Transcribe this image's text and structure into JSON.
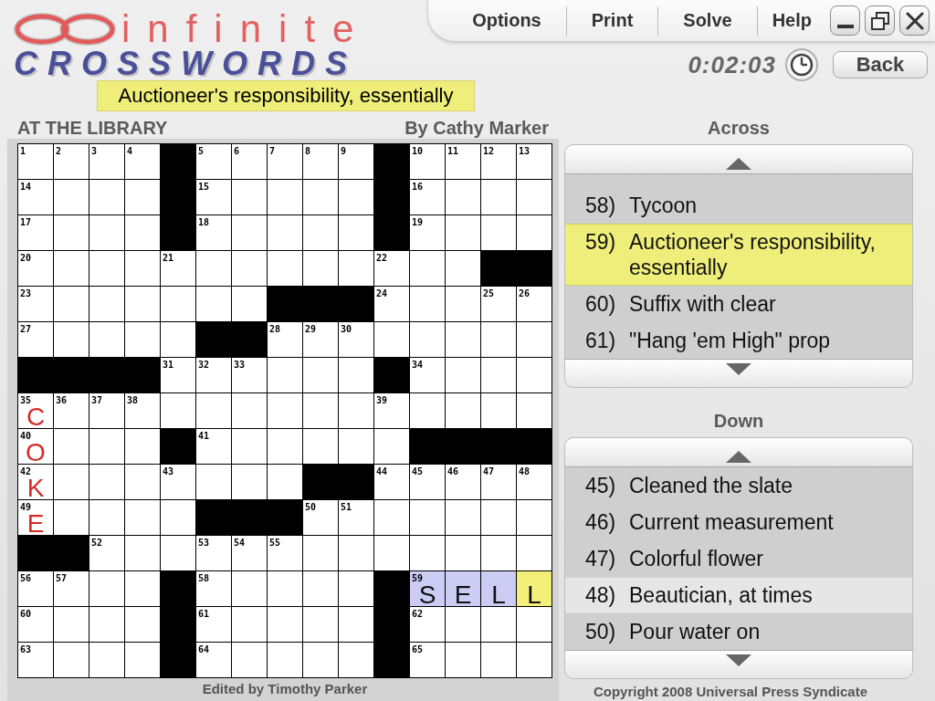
{
  "window": {
    "controls": [
      {
        "kind": "minimize"
      },
      {
        "kind": "restore"
      },
      {
        "kind": "close"
      }
    ]
  },
  "logo": {
    "line_1": "infinite",
    "line_2": "CROSSWORDS"
  },
  "menu": [
    "Options",
    "Print",
    "Solve",
    "Help"
  ],
  "timer": "0:02:03",
  "back_button": "Back",
  "current_clue": "Auctioneer's responsibility, essentially",
  "puzzle": {
    "title": "AT THE LIBRARY",
    "author": "By Cathy Marker"
  },
  "grid": {
    "rows": [
      [
        {
          "kind": "open",
          "number": "1",
          "selected": false,
          "highlighted": false
        },
        {
          "kind": "open",
          "number": "2",
          "selected": false,
          "highlighted": false
        },
        {
          "kind": "open",
          "number": "3",
          "selected": false,
          "highlighted": false
        },
        {
          "kind": "open",
          "number": "4",
          "selected": false,
          "highlighted": false
        },
        {
          "kind": "block"
        },
        {
          "kind": "open",
          "number": "5",
          "selected": false,
          "highlighted": false
        },
        {
          "kind": "open",
          "number": "6",
          "selected": false,
          "highlighted": false
        },
        {
          "kind": "open",
          "number": "7",
          "selected": false,
          "highlighted": false
        },
        {
          "kind": "open",
          "number": "8",
          "selected": false,
          "highlighted": false
        },
        {
          "kind": "open",
          "number": "9",
          "selected": false,
          "highlighted": false
        },
        {
          "kind": "block"
        },
        {
          "kind": "open",
          "number": "10",
          "selected": false,
          "highlighted": false
        },
        {
          "kind": "open",
          "number": "11",
          "selected": false,
          "highlighted": false
        },
        {
          "kind": "open",
          "number": "12",
          "selected": false,
          "highlighted": false
        },
        {
          "kind": "open",
          "number": "13",
          "selected": false,
          "highlighted": false
        }
      ],
      [
        {
          "kind": "open",
          "number": "14",
          "selected": false,
          "highlighted": false
        },
        {
          "kind": "open",
          "selected": false,
          "highlighted": false
        },
        {
          "kind": "open",
          "selected": false,
          "highlighted": false
        },
        {
          "kind": "open",
          "selected": false,
          "highlighted": false
        },
        {
          "kind": "block"
        },
        {
          "kind": "open",
          "number": "15",
          "selected": false,
          "highlighted": false
        },
        {
          "kind": "open",
          "selected": false,
          "highlighted": false
        },
        {
          "kind": "open",
          "selected": false,
          "highlighted": false
        },
        {
          "kind": "open",
          "selected": false,
          "highlighted": false
        },
        {
          "kind": "open",
          "selected": false,
          "highlighted": false
        },
        {
          "kind": "block"
        },
        {
          "kind": "open",
          "number": "16",
          "selected": false,
          "highlighted": false
        },
        {
          "kind": "open",
          "selected": false,
          "highlighted": false
        },
        {
          "kind": "open",
          "selected": false,
          "highlighted": false
        },
        {
          "kind": "open",
          "selected": false,
          "highlighted": false
        }
      ],
      [
        {
          "kind": "open",
          "number": "17",
          "selected": false,
          "highlighted": false
        },
        {
          "kind": "open",
          "selected": false,
          "highlighted": false
        },
        {
          "kind": "open",
          "selected": false,
          "highlighted": false
        },
        {
          "kind": "open",
          "selected": false,
          "highlighted": false
        },
        {
          "kind": "block"
        },
        {
          "kind": "open",
          "number": "18",
          "selected": false,
          "highlighted": false
        },
        {
          "kind": "open",
          "selected": false,
          "highlighted": false
        },
        {
          "kind": "open",
          "selected": false,
          "highlighted": false
        },
        {
          "kind": "open",
          "selected": false,
          "highlighted": false
        },
        {
          "kind": "open",
          "selected": false,
          "highlighted": false
        },
        {
          "kind": "block"
        },
        {
          "kind": "open",
          "number": "19",
          "selected": false,
          "highlighted": false
        },
        {
          "kind": "open",
          "selected": false,
          "highlighted": false
        },
        {
          "kind": "open",
          "selected": false,
          "highlighted": false
        },
        {
          "kind": "open",
          "selected": false,
          "highlighted": false
        }
      ],
      [
        {
          "kind": "open",
          "number": "20",
          "selected": false,
          "highlighted": false
        },
        {
          "kind": "open",
          "selected": false,
          "highlighted": false
        },
        {
          "kind": "open",
          "selected": false,
          "highlighted": false
        },
        {
          "kind": "open",
          "selected": false,
          "highlighted": false
        },
        {
          "kind": "open",
          "number": "21",
          "selected": false,
          "highlighted": false
        },
        {
          "kind": "open",
          "selected": false,
          "highlighted": false
        },
        {
          "kind": "open",
          "selected": false,
          "highlighted": false
        },
        {
          "kind": "open",
          "selected": false,
          "highlighted": false
        },
        {
          "kind": "open",
          "selected": false,
          "highlighted": false
        },
        {
          "kind": "open",
          "selected": false,
          "highlighted": false
        },
        {
          "kind": "open",
          "number": "22",
          "selected": false,
          "highlighted": false
        },
        {
          "kind": "open",
          "selected": false,
          "highlighted": false
        },
        {
          "kind": "open",
          "selected": false,
          "highlighted": false
        },
        {
          "kind": "block"
        },
        {
          "kind": "block"
        }
      ],
      [
        {
          "kind": "open",
          "number": "23",
          "selected": false,
          "highlighted": false
        },
        {
          "kind": "open",
          "selected": false,
          "highlighted": false
        },
        {
          "kind": "open",
          "selected": false,
          "highlighted": false
        },
        {
          "kind": "open",
          "selected": false,
          "highlighted": false
        },
        {
          "kind": "open",
          "selected": false,
          "highlighted": false
        },
        {
          "kind": "open",
          "selected": false,
          "highlighted": false
        },
        {
          "kind": "open",
          "selected": false,
          "highlighted": false
        },
        {
          "kind": "block"
        },
        {
          "kind": "block"
        },
        {
          "kind": "block"
        },
        {
          "kind": "open",
          "number": "24",
          "selected": false,
          "highlighted": false
        },
        {
          "kind": "open",
          "selected": false,
          "highlighted": false
        },
        {
          "kind": "open",
          "selected": false,
          "highlighted": false
        },
        {
          "kind": "open",
          "number": "25",
          "selected": false,
          "highlighted": false
        },
        {
          "kind": "open",
          "number": "26",
          "selected": false,
          "highlighted": false
        }
      ],
      [
        {
          "kind": "open",
          "number": "27",
          "selected": false,
          "highlighted": false
        },
        {
          "kind": "open",
          "selected": false,
          "highlighted": false
        },
        {
          "kind": "open",
          "selected": false,
          "highlighted": false
        },
        {
          "kind": "open",
          "selected": false,
          "highlighted": false
        },
        {
          "kind": "open",
          "selected": false,
          "highlighted": false
        },
        {
          "kind": "block"
        },
        {
          "kind": "block"
        },
        {
          "kind": "open",
          "number": "28",
          "selected": false,
          "highlighted": false
        },
        {
          "kind": "open",
          "number": "29",
          "selected": false,
          "highlighted": false
        },
        {
          "kind": "open",
          "number": "30",
          "selected": false,
          "highlighted": false
        },
        {
          "kind": "open",
          "selected": false,
          "highlighted": false
        },
        {
          "kind": "open",
          "selected": false,
          "highlighted": false
        },
        {
          "kind": "open",
          "selected": false,
          "highlighted": false
        },
        {
          "kind": "open",
          "selected": false,
          "highlighted": false
        },
        {
          "kind": "open",
          "selected": false,
          "highlighted": false
        }
      ],
      [
        {
          "kind": "block"
        },
        {
          "kind": "block"
        },
        {
          "kind": "block"
        },
        {
          "kind": "block"
        },
        {
          "kind": "open",
          "number": "31",
          "selected": false,
          "highlighted": false
        },
        {
          "kind": "open",
          "number": "32",
          "selected": false,
          "highlighted": false
        },
        {
          "kind": "open",
          "number": "33",
          "selected": false,
          "highlighted": false
        },
        {
          "kind": "open",
          "selected": false,
          "highlighted": false
        },
        {
          "kind": "open",
          "selected": false,
          "highlighted": false
        },
        {
          "kind": "open",
          "selected": false,
          "highlighted": false
        },
        {
          "kind": "block"
        },
        {
          "kind": "open",
          "number": "34",
          "selected": false,
          "highlighted": false
        },
        {
          "kind": "open",
          "selected": false,
          "highlighted": false
        },
        {
          "kind": "open",
          "selected": false,
          "highlighted": false
        },
        {
          "kind": "open",
          "selected": false,
          "highlighted": false
        }
      ],
      [
        {
          "kind": "open",
          "number": "35",
          "letter": "C",
          "color": "#d42a2a",
          "selected": false,
          "highlighted": false
        },
        {
          "kind": "open",
          "number": "36",
          "selected": false,
          "highlighted": false
        },
        {
          "kind": "open",
          "number": "37",
          "selected": false,
          "highlighted": false
        },
        {
          "kind": "open",
          "number": "38",
          "selected": false,
          "highlighted": false
        },
        {
          "kind": "open",
          "selected": false,
          "highlighted": false
        },
        {
          "kind": "open",
          "selected": false,
          "highlighted": false
        },
        {
          "kind": "open",
          "selected": false,
          "highlighted": false
        },
        {
          "kind": "open",
          "selected": false,
          "highlighted": false
        },
        {
          "kind": "open",
          "selected": false,
          "highlighted": false
        },
        {
          "kind": "open",
          "selected": false,
          "highlighted": false
        },
        {
          "kind": "open",
          "number": "39",
          "selected": false,
          "highlighted": false
        },
        {
          "kind": "open",
          "selected": false,
          "highlighted": false
        },
        {
          "kind": "open",
          "selected": false,
          "highlighted": false
        },
        {
          "kind": "open",
          "selected": false,
          "highlighted": false
        },
        {
          "kind": "open",
          "selected": false,
          "highlighted": false
        }
      ],
      [
        {
          "kind": "open",
          "number": "40",
          "letter": "O",
          "color": "#d42a2a",
          "selected": false,
          "highlighted": false
        },
        {
          "kind": "open",
          "selected": false,
          "highlighted": false
        },
        {
          "kind": "open",
          "selected": false,
          "highlighted": false
        },
        {
          "kind": "open",
          "selected": false,
          "highlighted": false
        },
        {
          "kind": "block"
        },
        {
          "kind": "open",
          "number": "41",
          "selected": false,
          "highlighted": false
        },
        {
          "kind": "open",
          "selected": false,
          "highlighted": false
        },
        {
          "kind": "open",
          "selected": false,
          "highlighted": false
        },
        {
          "kind": "open",
          "selected": false,
          "highlighted": false
        },
        {
          "kind": "open",
          "selected": false,
          "highlighted": false
        },
        {
          "kind": "open",
          "selected": false,
          "highlighted": false
        },
        {
          "kind": "block"
        },
        {
          "kind": "block"
        },
        {
          "kind": "block"
        },
        {
          "kind": "block"
        }
      ],
      [
        {
          "kind": "open",
          "number": "42",
          "letter": "K",
          "color": "#d42a2a",
          "selected": false,
          "highlighted": false
        },
        {
          "kind": "open",
          "selected": false,
          "highlighted": false
        },
        {
          "kind": "open",
          "selected": false,
          "highlighted": false
        },
        {
          "kind": "open",
          "selected": false,
          "highlighted": false
        },
        {
          "kind": "open",
          "number": "43",
          "selected": false,
          "highlighted": false
        },
        {
          "kind": "open",
          "selected": false,
          "highlighted": false
        },
        {
          "kind": "open",
          "selected": false,
          "highlighted": false
        },
        {
          "kind": "open",
          "selected": false,
          "highlighted": false
        },
        {
          "kind": "block"
        },
        {
          "kind": "block"
        },
        {
          "kind": "open",
          "number": "44",
          "selected": false,
          "highlighted": false
        },
        {
          "kind": "open",
          "number": "45",
          "selected": false,
          "highlighted": false
        },
        {
          "kind": "open",
          "number": "46",
          "selected": false,
          "highlighted": false
        },
        {
          "kind": "open",
          "number": "47",
          "selected": false,
          "highlighted": false
        },
        {
          "kind": "open",
          "number": "48",
          "selected": false,
          "highlighted": false
        }
      ],
      [
        {
          "kind": "open",
          "number": "49",
          "letter": "E",
          "color": "#d42a2a",
          "selected": false,
          "highlighted": false
        },
        {
          "kind": "open",
          "selected": false,
          "highlighted": false
        },
        {
          "kind": "open",
          "selected": false,
          "highlighted": false
        },
        {
          "kind": "open",
          "selected": false,
          "highlighted": false
        },
        {
          "kind": "open",
          "selected": false,
          "highlighted": false
        },
        {
          "kind": "block"
        },
        {
          "kind": "block"
        },
        {
          "kind": "block"
        },
        {
          "kind": "open",
          "number": "50",
          "selected": false,
          "highlighted": false
        },
        {
          "kind": "open",
          "number": "51",
          "selected": false,
          "highlighted": false
        },
        {
          "kind": "open",
          "selected": false,
          "highlighted": false
        },
        {
          "kind": "open",
          "selected": false,
          "highlighted": false
        },
        {
          "kind": "open",
          "selected": false,
          "highlighted": false
        },
        {
          "kind": "open",
          "selected": false,
          "highlighted": false
        },
        {
          "kind": "open",
          "selected": false,
          "highlighted": false
        }
      ],
      [
        {
          "kind": "block"
        },
        {
          "kind": "block"
        },
        {
          "kind": "open",
          "number": "52",
          "selected": false,
          "highlighted": false
        },
        {
          "kind": "open",
          "selected": false,
          "highlighted": false
        },
        {
          "kind": "open",
          "selected": false,
          "highlighted": false
        },
        {
          "kind": "open",
          "number": "53",
          "selected": false,
          "highlighted": false
        },
        {
          "kind": "open",
          "number": "54",
          "selected": false,
          "highlighted": false
        },
        {
          "kind": "open",
          "number": "55",
          "selected": false,
          "highlighted": false
        },
        {
          "kind": "open",
          "selected": false,
          "highlighted": false
        },
        {
          "kind": "open",
          "selected": false,
          "highlighted": false
        },
        {
          "kind": "open",
          "selected": false,
          "highlighted": false
        },
        {
          "kind": "open",
          "selected": false,
          "highlighted": false
        },
        {
          "kind": "open",
          "selected": false,
          "highlighted": false
        },
        {
          "kind": "open",
          "selected": false,
          "highlighted": false
        },
        {
          "kind": "open",
          "selected": false,
          "highlighted": false
        }
      ],
      [
        {
          "kind": "open",
          "number": "56",
          "selected": false,
          "highlighted": false
        },
        {
          "kind": "open",
          "number": "57",
          "selected": false,
          "highlighted": false
        },
        {
          "kind": "open",
          "selected": false,
          "highlighted": false
        },
        {
          "kind": "open",
          "selected": false,
          "highlighted": false
        },
        {
          "kind": "block"
        },
        {
          "kind": "open",
          "number": "58",
          "selected": false,
          "highlighted": false
        },
        {
          "kind": "open",
          "selected": false,
          "highlighted": false
        },
        {
          "kind": "open",
          "selected": false,
          "highlighted": false
        },
        {
          "kind": "open",
          "selected": false,
          "highlighted": false
        },
        {
          "kind": "open",
          "selected": false,
          "highlighted": false
        },
        {
          "kind": "block"
        },
        {
          "kind": "open",
          "number": "59",
          "letter": "S",
          "color": "#111111",
          "selected": false,
          "highlighted": true
        },
        {
          "kind": "open",
          "letter": "E",
          "color": "#111111",
          "selected": false,
          "highlighted": true
        },
        {
          "kind": "open",
          "letter": "L",
          "color": "#111111",
          "selected": false,
          "highlighted": true
        },
        {
          "kind": "open",
          "letter": "L",
          "color": "#111111",
          "selected": true,
          "highlighted": false
        }
      ],
      [
        {
          "kind": "open",
          "number": "60",
          "selected": false,
          "highlighted": false
        },
        {
          "kind": "open",
          "selected": false,
          "highlighted": false
        },
        {
          "kind": "open",
          "selected": false,
          "highlighted": false
        },
        {
          "kind": "open",
          "selected": false,
          "highlighted": false
        },
        {
          "kind": "block"
        },
        {
          "kind": "open",
          "number": "61",
          "selected": false,
          "highlighted": false
        },
        {
          "kind": "open",
          "selected": false,
          "highlighted": false
        },
        {
          "kind": "open",
          "selected": false,
          "highlighted": false
        },
        {
          "kind": "open",
          "selected": false,
          "highlighted": false
        },
        {
          "kind": "open",
          "selected": false,
          "highlighted": false
        },
        {
          "kind": "block"
        },
        {
          "kind": "open",
          "number": "62",
          "selected": false,
          "highlighted": false
        },
        {
          "kind": "open",
          "selected": false,
          "highlighted": false
        },
        {
          "kind": "open",
          "selected": false,
          "highlighted": false
        },
        {
          "kind": "open",
          "selected": false,
          "highlighted": false
        }
      ],
      [
        {
          "kind": "open",
          "number": "63",
          "selected": false,
          "highlighted": false
        },
        {
          "kind": "open",
          "selected": false,
          "highlighted": false
        },
        {
          "kind": "open",
          "selected": false,
          "highlighted": false
        },
        {
          "kind": "open",
          "selected": false,
          "highlighted": false
        },
        {
          "kind": "block"
        },
        {
          "kind": "open",
          "number": "64",
          "selected": false,
          "highlighted": false
        },
        {
          "kind": "open",
          "selected": false,
          "highlighted": false
        },
        {
          "kind": "open",
          "selected": false,
          "highlighted": false
        },
        {
          "kind": "open",
          "selected": false,
          "highlighted": false
        },
        {
          "kind": "open",
          "selected": false,
          "highlighted": false
        },
        {
          "kind": "block"
        },
        {
          "kind": "open",
          "number": "65",
          "selected": false,
          "highlighted": false
        },
        {
          "kind": "open",
          "selected": false,
          "highlighted": false
        },
        {
          "kind": "open",
          "selected": false,
          "highlighted": false
        },
        {
          "kind": "open",
          "selected": false,
          "highlighted": false
        }
      ]
    ]
  },
  "editor": "Edited by Timothy Parker",
  "across": {
    "heading": "Across",
    "clues": [
      {
        "number": "58)",
        "text": "Tycoon",
        "selected": false,
        "highlighted": false
      },
      {
        "number": "59)",
        "text": "Auctioneer's responsibility, essentially",
        "selected": true,
        "highlighted": false
      },
      {
        "number": "60)",
        "text": "Suffix with clear",
        "selected": false,
        "highlighted": false
      },
      {
        "number": "61)",
        "text": "\"Hang 'em High\" prop",
        "selected": false,
        "highlighted": false
      }
    ]
  },
  "down": {
    "heading": "Down",
    "clues": [
      {
        "number": "45)",
        "text": "Cleaned the slate",
        "selected": false,
        "highlighted": false
      },
      {
        "number": "46)",
        "text": "Current measurement",
        "selected": false,
        "highlighted": false
      },
      {
        "number": "47)",
        "text": "Colorful flower",
        "selected": false,
        "highlighted": false
      },
      {
        "number": "48)",
        "text": "Beautician, at times",
        "selected": false,
        "highlighted": true
      },
      {
        "number": "50)",
        "text": "Pour water on",
        "selected": false,
        "highlighted": false
      }
    ]
  },
  "copyright": "Copyright 2008 Universal Press Syndicate"
}
